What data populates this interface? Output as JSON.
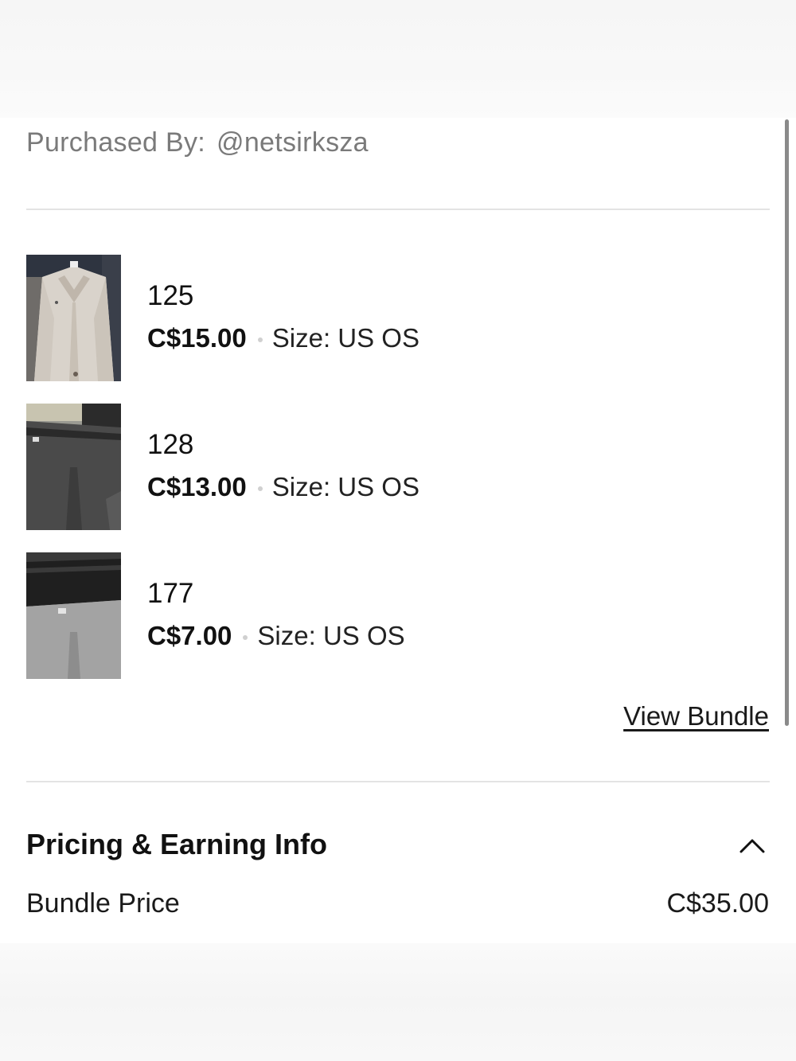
{
  "purchase": {
    "label": "Purchased By:",
    "username": "@netsirksza"
  },
  "items": [
    {
      "title": "125",
      "price": "C$15.00",
      "size": "Size: US OS",
      "image": "beige-coat-thumbnail"
    },
    {
      "title": "128",
      "price": "C$13.00",
      "size": "Size: US OS",
      "image": "grey-leggings-thumbnail"
    },
    {
      "title": "177",
      "price": "C$7.00",
      "size": "Size: US OS",
      "image": "grey-sweatpants-thumbnail"
    }
  ],
  "bundle": {
    "view_label": "View Bundle"
  },
  "pricing": {
    "title": "Pricing & Earning Info",
    "toggle_icon": "chevron-up-icon",
    "rows": [
      {
        "label": "Bundle Price",
        "value": "C$35.00"
      }
    ]
  },
  "colors": {
    "text": "#1a1a1a",
    "muted": "#7a7a7a",
    "divider": "#e3e3e3"
  }
}
